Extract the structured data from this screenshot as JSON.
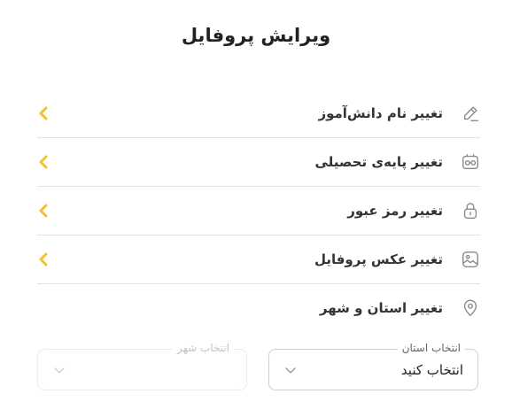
{
  "page": {
    "title": "ویرایش پروفایل"
  },
  "colors": {
    "accent": "#f2c12e",
    "icon": "#8a8a8a",
    "divider": "#e2e2e2"
  },
  "menu": {
    "items": [
      {
        "label": "تغییر نام دانش‌آموز",
        "icon": "pencil-icon",
        "has_arrow": true
      },
      {
        "label": "تغییر پایه‌ی تحصیلی",
        "icon": "grade-icon",
        "has_arrow": true
      },
      {
        "label": "تغییر رمز عبور",
        "icon": "lock-icon",
        "has_arrow": true
      },
      {
        "label": "تغییر عکس پروفایل",
        "icon": "image-icon",
        "has_arrow": true
      },
      {
        "label": "تغییر استان و شهر",
        "icon": "location-pin-icon",
        "has_arrow": false
      }
    ]
  },
  "location_form": {
    "province": {
      "label": "انتخاب استان",
      "value": "انتخاب کنید"
    },
    "city": {
      "label": "انتخاب شهر",
      "value": ""
    }
  }
}
